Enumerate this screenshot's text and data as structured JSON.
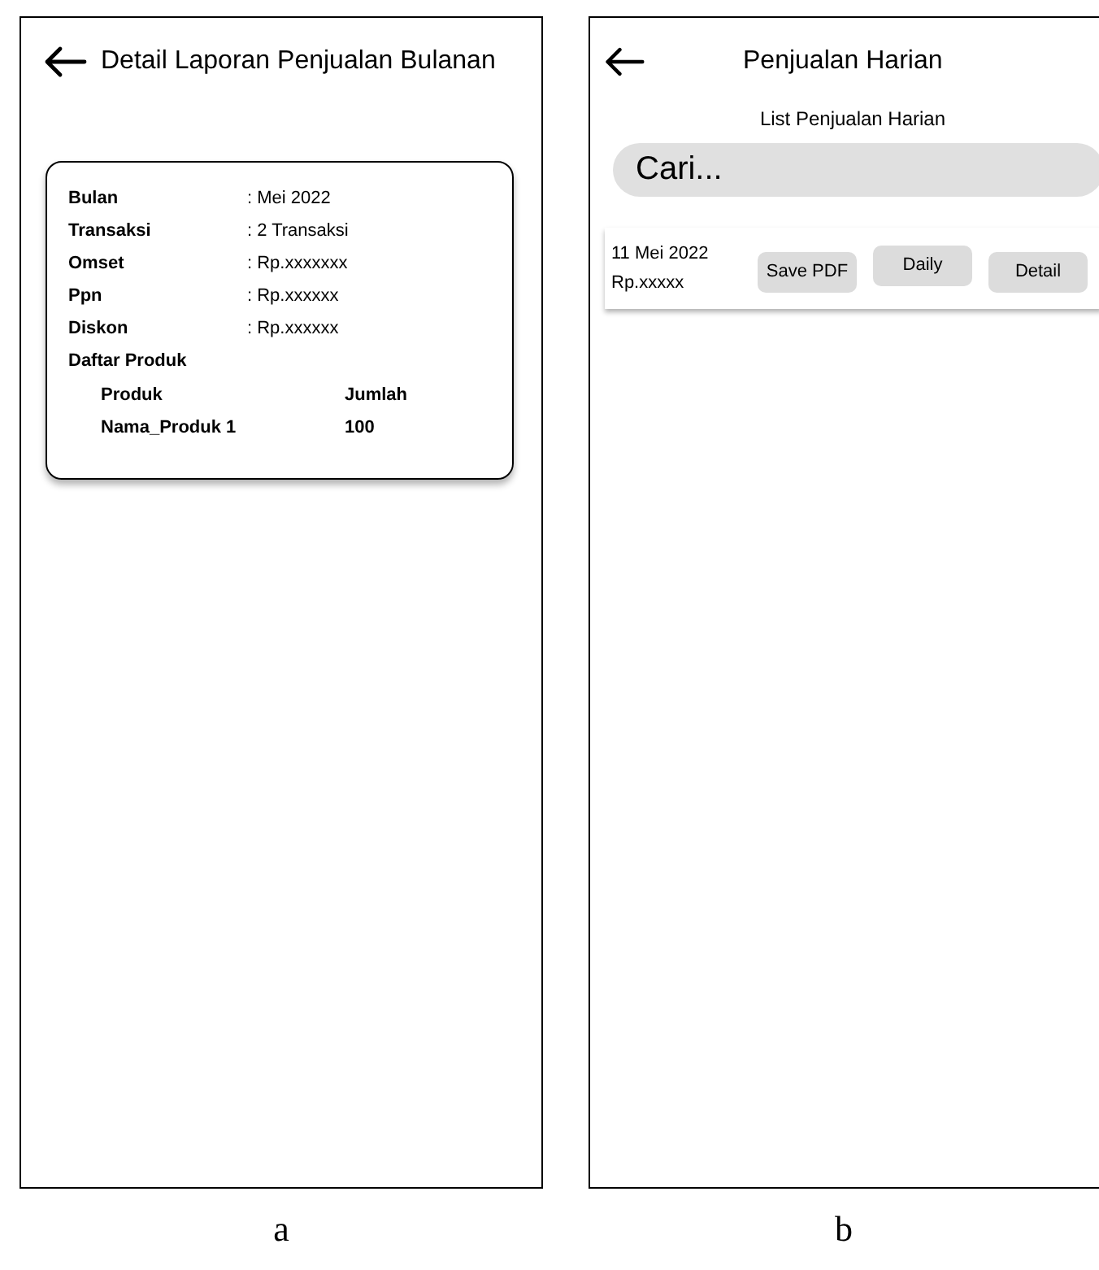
{
  "screen_a": {
    "title": "Detail Laporan Penjualan Bulanan",
    "fields": [
      {
        "label": "Bulan",
        "value": ": Mei 2022"
      },
      {
        "label": "Transaksi",
        "value": ": 2 Transaksi"
      },
      {
        "label": "Omset",
        "value": ": Rp.xxxxxxx"
      },
      {
        "label": "Ppn",
        "value": ": Rp.xxxxxx"
      },
      {
        "label": "Diskon",
        "value": ": Rp.xxxxxx"
      }
    ],
    "products_heading": "Daftar Produk",
    "product_columns": [
      "Produk",
      "Jumlah"
    ],
    "product_rows": [
      [
        "Nama_Produk 1",
        "100"
      ]
    ],
    "caption": "a"
  },
  "screen_b": {
    "title": "Penjualan Harian",
    "subtitle": "List Penjualan Harian",
    "search": {
      "placeholder": "Cari..."
    },
    "items": [
      {
        "date": "11 Mei 2022",
        "amount": "Rp.xxxxx",
        "buttons": [
          "Save PDF",
          "Daily",
          "Detail"
        ]
      }
    ],
    "caption": "b"
  }
}
